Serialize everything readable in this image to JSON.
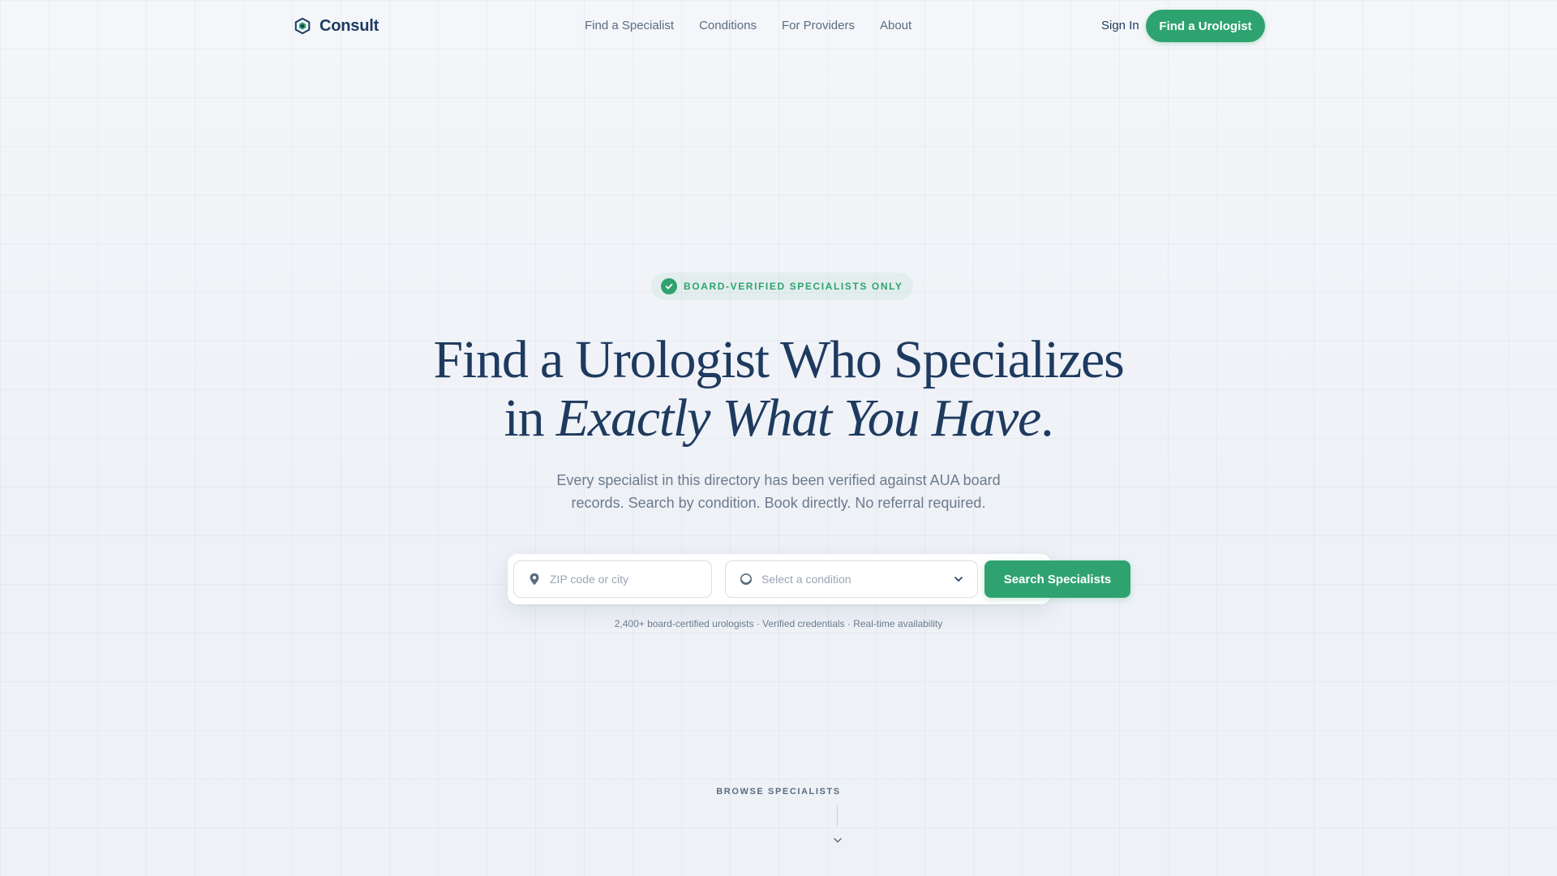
{
  "header": {
    "brand": "Consult",
    "nav": [
      "Find a Specialist",
      "Conditions",
      "For Providers",
      "About"
    ],
    "signin_label": "Sign In",
    "cta_label": "Find a Urologist"
  },
  "hero": {
    "badge": "BOARD-VERIFIED SPECIALISTS ONLY",
    "headline_line1": "Find a Urologist Who Specializes",
    "headline_line2_prefix": "in ",
    "headline_line2_em": "Exactly What You Have",
    "headline_line2_suffix": ".",
    "subhead": "Every specialist in this directory has been verified against AUA board records. Search by condition. Book directly. No referral required."
  },
  "search": {
    "zip_placeholder": "ZIP code or city",
    "condition_placeholder": "Select a condition",
    "button_label": "Search Specialists",
    "meta": "2,400+ board-certified urologists · Verified credentials · Real-time availability"
  },
  "browse": {
    "label": "BROWSE SPECIALISTS"
  },
  "colors": {
    "accent": "#2ea36f",
    "navy": "#1e3a5f",
    "muted": "#6b7a8d"
  },
  "icons": {
    "brand": "hexagon-logo-icon",
    "badge": "check-circle-icon",
    "zip": "map-pin-icon",
    "condition": "circle-icon",
    "select": "chevron-down-icon",
    "browse": "chevron-down-icon"
  }
}
